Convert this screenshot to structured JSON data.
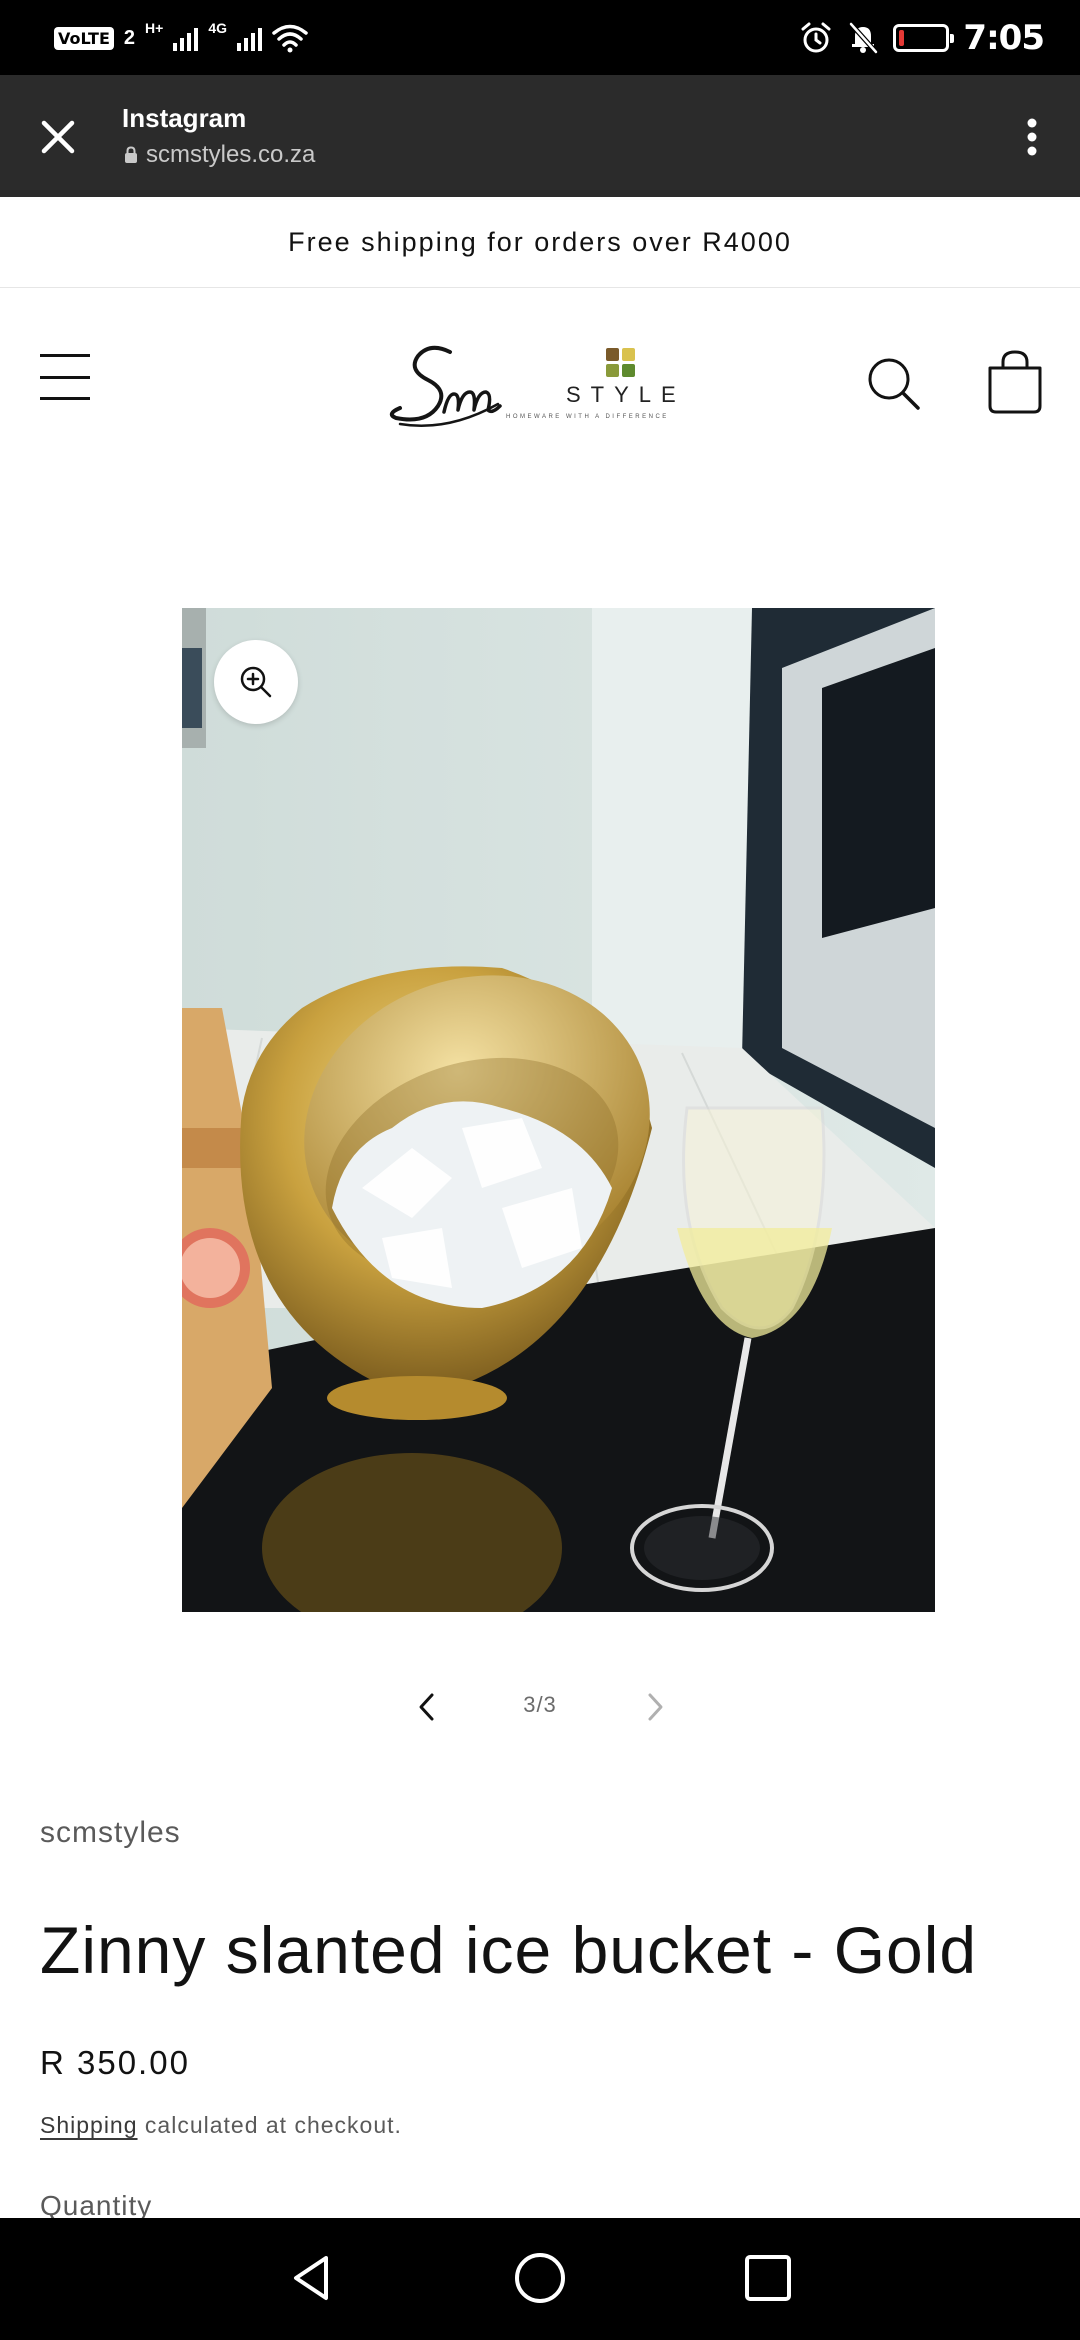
{
  "status_bar": {
    "volte": "VoLTE",
    "sim_number": "2",
    "network_1": "H+",
    "network_2": "4G",
    "time": "7:05",
    "battery_level": 0.12,
    "battery_color": "#e53935"
  },
  "browser": {
    "title": "Instagram",
    "url": "scmstyles.co.za",
    "close_icon": "close-icon",
    "menu_icon": "more-vert-icon",
    "lock_icon": "lock-icon"
  },
  "announcement": "Free shipping for orders over R4000",
  "header": {
    "logo_script": "Sm",
    "logo_word": "STYLE",
    "logo_tagline": "HOMEWARE WITH A DIFFERENCE",
    "logo_square_colors": [
      "#7a5a2a",
      "#d9c24e",
      "#8a9a3a",
      "#5e8a2e"
    ]
  },
  "product": {
    "slide_counter": "3/3",
    "vendor": "scmstyles",
    "title": "Zinny slanted ice bucket - Gold",
    "price": "R 350.00",
    "shipping_link": "Shipping",
    "shipping_rest": " calculated at checkout.",
    "quantity_label": "Quantity"
  }
}
